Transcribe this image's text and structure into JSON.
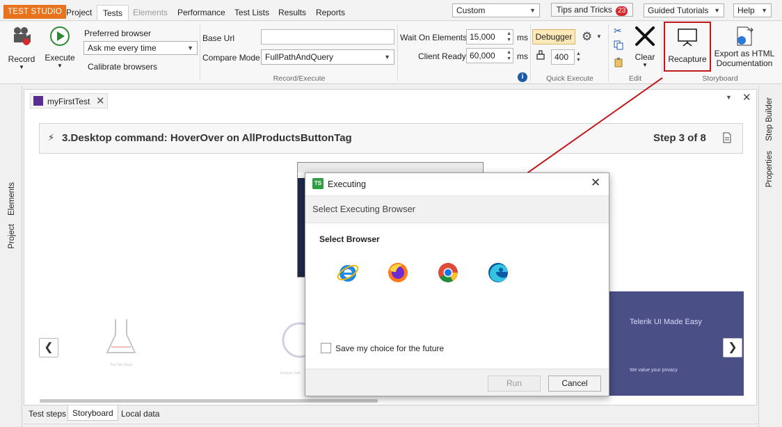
{
  "app": {
    "brand": "TEST STUDIO"
  },
  "menu": {
    "tabs": [
      {
        "label": "Project"
      },
      {
        "label": "Tests"
      },
      {
        "label": "Elements"
      },
      {
        "label": "Performance"
      },
      {
        "label": "Test Lists"
      },
      {
        "label": "Results"
      },
      {
        "label": "Reports"
      }
    ],
    "layout_combo": "Custom",
    "tips_label": "Tips and Tricks",
    "tips_badge": "23",
    "guided_label": "Guided Tutorials",
    "help_label": "Help"
  },
  "ribbon": {
    "record_label": "Record",
    "execute_label": "Execute",
    "preferred_browser_label": "Preferred browser",
    "preferred_browser_value": "Ask me every time",
    "calibrate_label": "Calibrate browsers",
    "base_url_label": "Base Url",
    "base_url_value": "",
    "compare_mode_label": "Compare Mode",
    "compare_mode_value": "FullPathAndQuery",
    "group_record_execute": "Record/Execute",
    "wait_on_elements_label": "Wait On Elements",
    "wait_on_elements_value": "15,000",
    "client_ready_label": "Client Ready",
    "client_ready_value": "60,000",
    "ms_unit": "ms",
    "debugger_label": "Debugger",
    "quick_value": "400",
    "group_quick_execute": "Quick Execute",
    "clear_label": "Clear",
    "group_edit": "Edit",
    "recapture_label": "Recapture",
    "export_label_1": "Export as HTML",
    "export_label_2": "Documentation",
    "group_storyboard": "Storyboard"
  },
  "left_strip": {
    "elements": "Elements",
    "project": "Project"
  },
  "right_strip": {
    "step_builder": "Step Builder",
    "properties": "Properties"
  },
  "document": {
    "tab_title": "myFirstTest",
    "step_title": "3.Desktop command: HoverOver on AllProductsButtonTag",
    "step_counter": "Step 3 of 8",
    "thumb_caption_1": "Test Tab Steps",
    "thumb_caption_2": "Execute Test",
    "site_heading": "Telerik UI Made Easy",
    "site_privacy": "We value your privacy"
  },
  "bottom_tabs": [
    {
      "label": "Test steps"
    },
    {
      "label": "Storyboard"
    },
    {
      "label": "Local data"
    }
  ],
  "dialog": {
    "title": "Executing",
    "subtitle": "Select Executing Browser",
    "section_label": "Select Browser",
    "browsers": [
      {
        "name": "internet-explorer-icon"
      },
      {
        "name": "firefox-icon"
      },
      {
        "name": "chrome-icon"
      },
      {
        "name": "edge-icon"
      }
    ],
    "remember_label": "Save my choice for the future",
    "run_label": "Run",
    "cancel_label": "Cancel"
  },
  "colors": {
    "brand_orange": "#e8731c",
    "highlight_red": "#c0181c",
    "debugger_fill": "#fde8b7",
    "badge_red": "#d9272e"
  }
}
